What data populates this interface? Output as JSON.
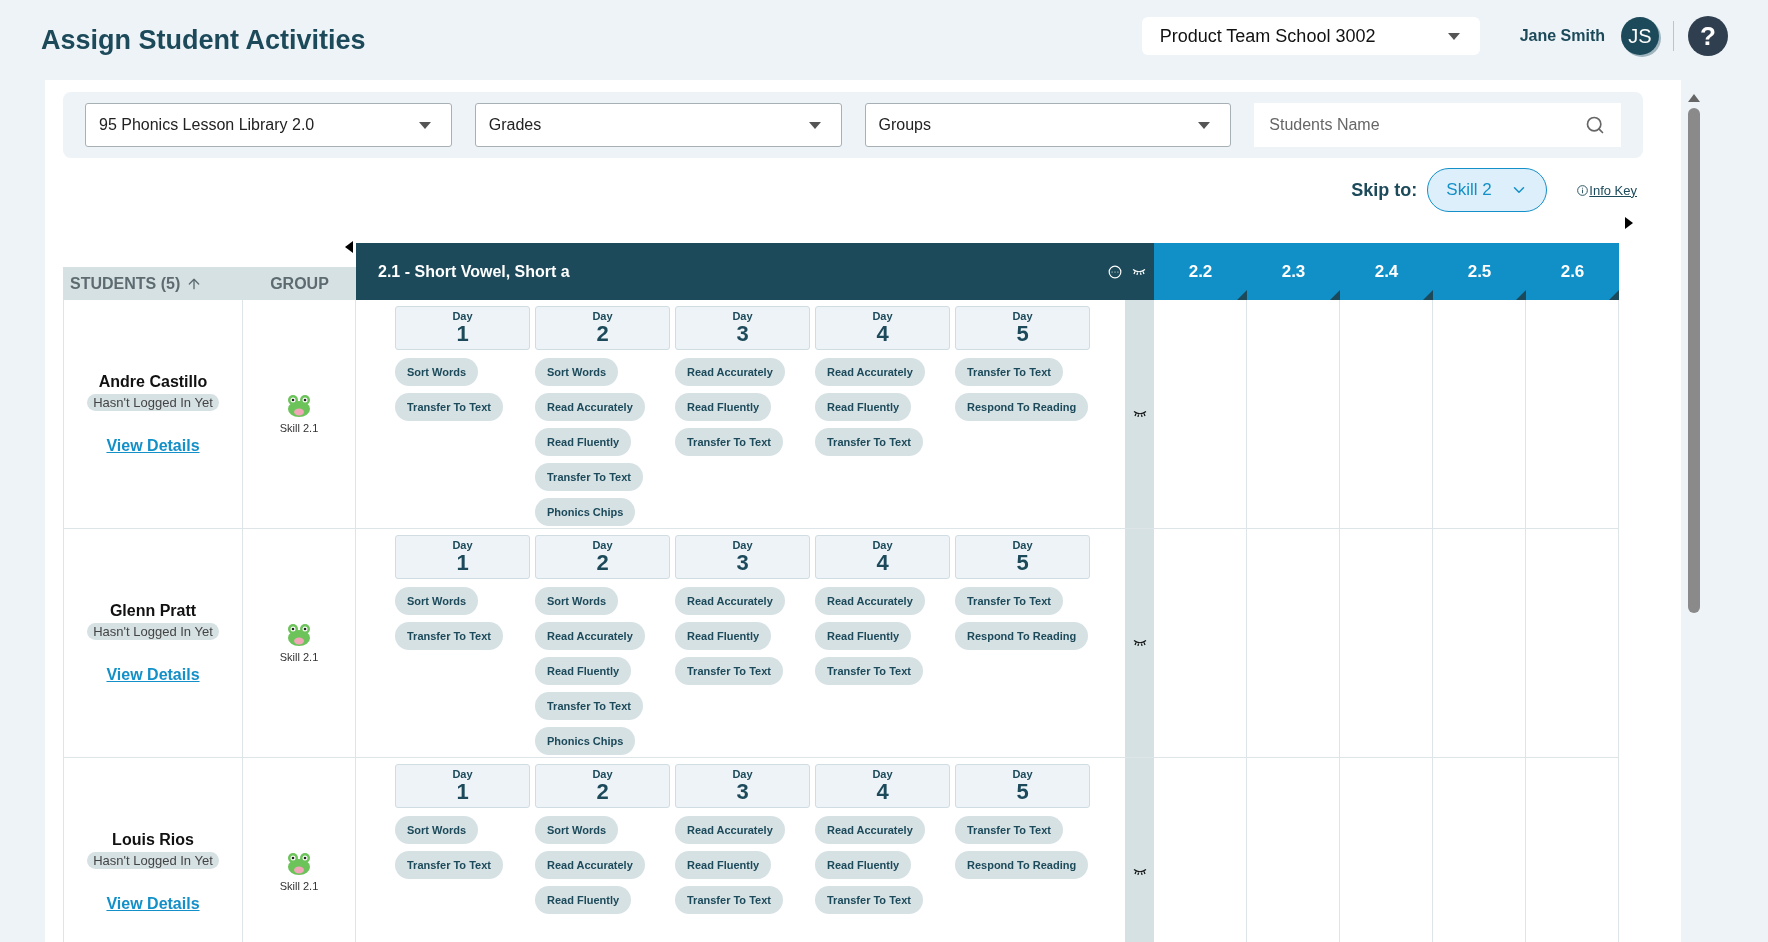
{
  "header": {
    "title": "Assign Student Activities",
    "school": "Product Team School 3002",
    "user_name": "Jane Smith",
    "avatar_initials": "JS",
    "help": "?"
  },
  "filters": {
    "library": "95 Phonics Lesson Library 2.0",
    "grades": "Grades",
    "groups": "Groups",
    "search_placeholder": "Students Name"
  },
  "skip": {
    "label": "Skip to:",
    "value": "Skill 2",
    "info_key": "Info Key"
  },
  "table": {
    "students_header": "STUDENTS (5)",
    "group_header": "GROUP",
    "skill_header": "2.1 - Short Vowel, Short a",
    "other_skills": [
      "2.2",
      "2.3",
      "2.4",
      "2.5",
      "2.6"
    ],
    "rows": [
      {
        "name": "Andre Castillo",
        "status": "Hasn't Logged In Yet",
        "link": "View Details",
        "group": "Skill 2.1",
        "days": [
          {
            "label": "Day",
            "number": "1",
            "activities": [
              "Sort Words",
              "Transfer To Text"
            ]
          },
          {
            "label": "Day",
            "number": "2",
            "activities": [
              "Sort Words",
              "Read Accurately",
              "Read Fluently",
              "Transfer To Text",
              "Phonics Chips"
            ]
          },
          {
            "label": "Day",
            "number": "3",
            "activities": [
              "Read Accurately",
              "Read Fluently",
              "Transfer To Text"
            ]
          },
          {
            "label": "Day",
            "number": "4",
            "activities": [
              "Read Accurately",
              "Read Fluently",
              "Transfer To Text"
            ]
          },
          {
            "label": "Day",
            "number": "5",
            "activities": [
              "Transfer To Text",
              "Respond To Reading"
            ]
          }
        ]
      },
      {
        "name": "Glenn Pratt",
        "status": "Hasn't Logged In Yet",
        "link": "View Details",
        "group": "Skill 2.1",
        "days": [
          {
            "label": "Day",
            "number": "1",
            "activities": [
              "Sort Words",
              "Transfer To Text"
            ]
          },
          {
            "label": "Day",
            "number": "2",
            "activities": [
              "Sort Words",
              "Read Accurately",
              "Read Fluently",
              "Transfer To Text",
              "Phonics Chips"
            ]
          },
          {
            "label": "Day",
            "number": "3",
            "activities": [
              "Read Accurately",
              "Read Fluently",
              "Transfer To Text"
            ]
          },
          {
            "label": "Day",
            "number": "4",
            "activities": [
              "Read Accurately",
              "Read Fluently",
              "Transfer To Text"
            ]
          },
          {
            "label": "Day",
            "number": "5",
            "activities": [
              "Transfer To Text",
              "Respond To Reading"
            ]
          }
        ]
      },
      {
        "name": "Louis Rios",
        "status": "Hasn't Logged In Yet",
        "link": "View Details",
        "group": "Skill 2.1",
        "days": [
          {
            "label": "Day",
            "number": "1",
            "activities": [
              "Sort Words",
              "Transfer To Text"
            ]
          },
          {
            "label": "Day",
            "number": "2",
            "activities": [
              "Sort Words",
              "Read Accurately",
              "Read Fluently"
            ]
          },
          {
            "label": "Day",
            "number": "3",
            "activities": [
              "Read Accurately",
              "Read Fluently",
              "Transfer To Text"
            ]
          },
          {
            "label": "Day",
            "number": "4",
            "activities": [
              "Read Accurately",
              "Read Fluently",
              "Transfer To Text"
            ]
          },
          {
            "label": "Day",
            "number": "5",
            "activities": [
              "Transfer To Text",
              "Respond To Reading"
            ]
          }
        ]
      }
    ]
  }
}
